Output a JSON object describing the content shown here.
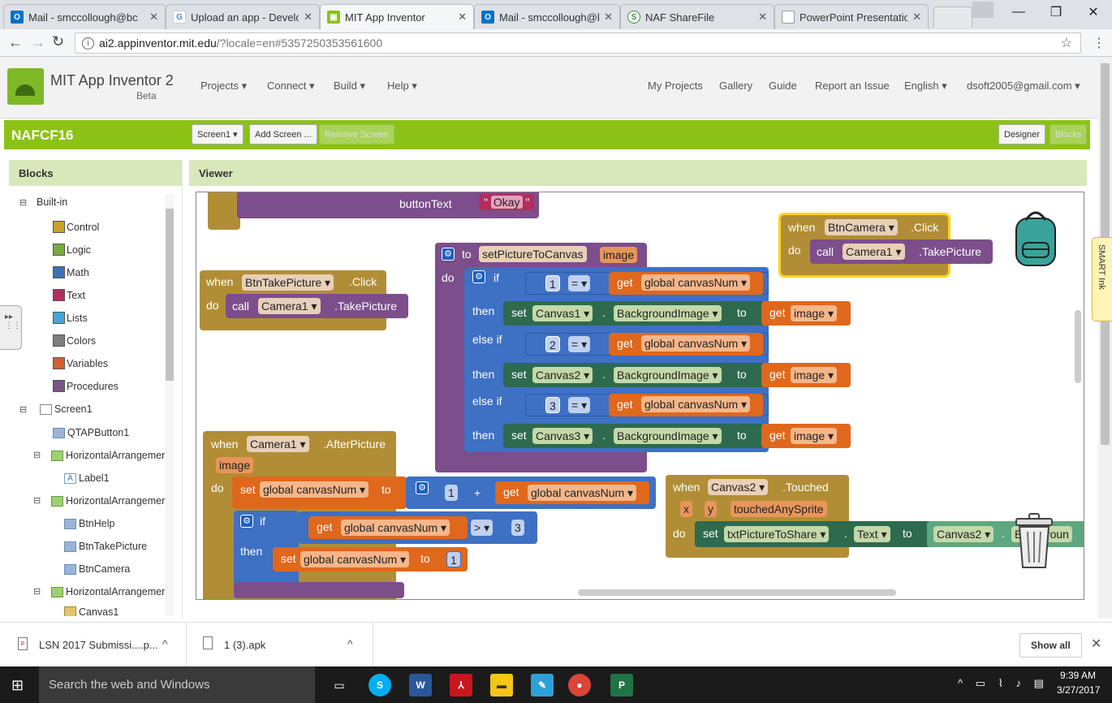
{
  "browser": {
    "tabs": [
      {
        "title": "Mail - smccollough@bc",
        "icon": "outlook-icon"
      },
      {
        "title": "Upload an app - Develo",
        "icon": "google-icon"
      },
      {
        "title": "MIT App Inventor",
        "icon": "appinventor-icon"
      },
      {
        "title": "Mail - smccollough@bc",
        "icon": "outlook-icon"
      },
      {
        "title": "NAF ShareFile",
        "icon": "sharefile-icon"
      },
      {
        "title": "PowerPoint Presentatio",
        "icon": "document-icon"
      }
    ],
    "url_host": "ai2.appinventor.mit.edu",
    "url_rest": "/?locale=en#5357250353561600"
  },
  "app": {
    "title": "MIT App Inventor 2",
    "subtitle": "Beta",
    "menu_left": [
      "Projects ▾",
      "Connect ▾",
      "Build ▾",
      "Help ▾"
    ],
    "menu_right": [
      "My Projects",
      "Gallery",
      "Guide",
      "Report an Issue",
      "English ▾",
      "dsoft2005@gmail.com ▾"
    ],
    "project_name": "NAFCF16",
    "screen_select": "Screen1 ▾",
    "add_screen": "Add Screen ...",
    "remove_screen": "Remove Screen",
    "designer": "Designer",
    "blocks_btn": "Blocks"
  },
  "blocks_panel": {
    "header": "Blocks",
    "builtin": "Built-in",
    "builtin_items": [
      {
        "label": "Control",
        "color": "#c9a227"
      },
      {
        "label": "Logic",
        "color": "#77ab41"
      },
      {
        "label": "Math",
        "color": "#3f71b5"
      },
      {
        "label": "Text",
        "color": "#b32d5e"
      },
      {
        "label": "Lists",
        "color": "#49a6d4"
      },
      {
        "label": "Colors",
        "color": "#7d7d7d"
      },
      {
        "label": "Variables",
        "color": "#d05f2d"
      },
      {
        "label": "Procedures",
        "color": "#7c5385"
      }
    ],
    "screen": "Screen1",
    "components": [
      "QTAPButton1",
      "HorizontalArrangemer",
      "Label1",
      "HorizontalArrangemer",
      "BtnHelp",
      "BtnTakePicture",
      "BtnCamera",
      "HorizontalArrangemer",
      "Canvas1"
    ]
  },
  "viewer": {
    "header": "Viewer",
    "smart_ink": "SMART Ink",
    "blocks": {
      "b0": {
        "buttonText": "buttonText",
        "okay": "Okay"
      },
      "b1": {
        "when": "when",
        "comp": "BtnTakePicture",
        "event": ".Click",
        "do": "do",
        "call": "call",
        "cam": "Camera1",
        "method": ".TakePicture"
      },
      "b2": {
        "to": "to",
        "name": "setPictureToCanvas",
        "param": "image",
        "do": "do",
        "if": "if",
        "n1": "1",
        "n2": "2",
        "n3": "3",
        "eq": "=",
        "get": "get",
        "var": "global canvasNum",
        "then": "then",
        "elseif": "else if",
        "set": "set",
        "c1": "Canvas1",
        "c2": "Canvas2",
        "c3": "Canvas3",
        "prop": "BackgroundImage",
        "to2": "to",
        "img": "image"
      },
      "b3": {
        "when": "when",
        "comp": "BtnCamera",
        "event": ".Click",
        "do": "do",
        "call": "call",
        "cam": "Camera1",
        "method": ".TakePicture"
      },
      "b4": {
        "when": "when",
        "comp": "Camera1",
        "event": ".AfterPicture",
        "param": "image",
        "do": "do",
        "set": "set",
        "var": "global canvasNum",
        "to": "to",
        "one": "1",
        "plus": "+",
        "get": "get",
        "if": "if",
        "gt": ">",
        "three": "3",
        "then": "then"
      },
      "b5": {
        "when": "when",
        "comp": "Canvas2",
        "event": ".Touched",
        "x": "x",
        "y": "y",
        "touched": "touchedAnySprite",
        "do": "do",
        "set": "set",
        "target": "txtPictureToShare",
        "prop": "Text",
        "to": "to",
        "comp2": "Canvas2",
        "prop2": "Backgroun"
      }
    }
  },
  "downloads": {
    "items": [
      "LSN 2017 Submissi....p...",
      "1 (3).apk"
    ],
    "show_all": "Show all"
  },
  "taskbar": {
    "search": "Search the web and Windows",
    "time": "9:39 AM",
    "date": "3/27/2017"
  }
}
